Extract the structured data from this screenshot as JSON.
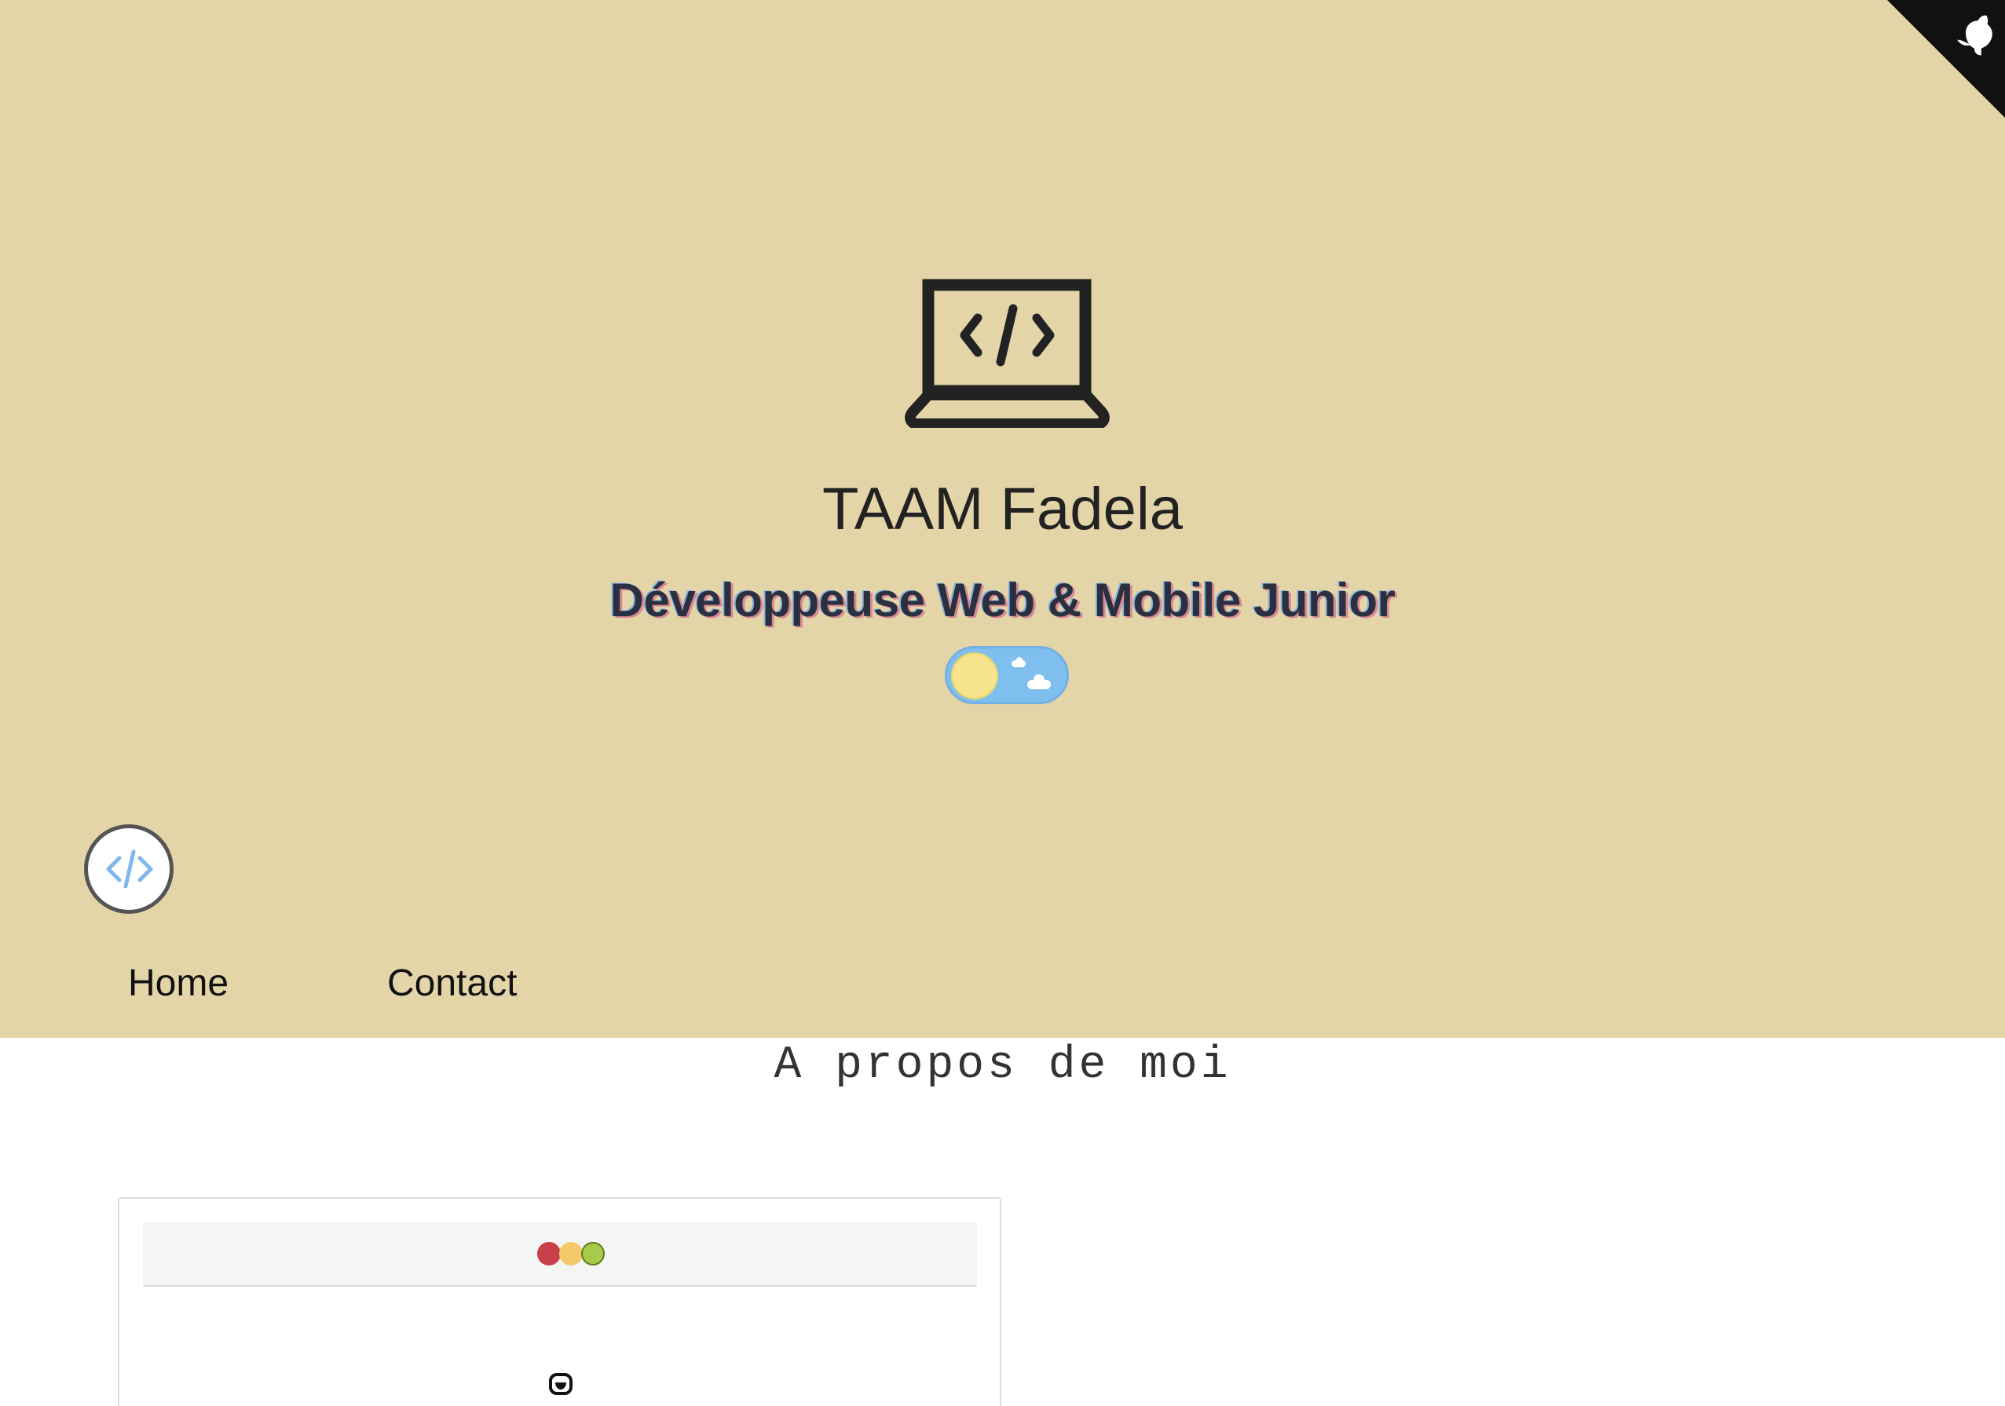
{
  "hero": {
    "title": "TAAM Fadela",
    "subtitle": "Développeuse Web & Mobile Junior",
    "background_color": "#e4d5a8",
    "icon": "laptop-code-icon"
  },
  "github_corner": {
    "icon": "github-octocat-icon",
    "color": "#111111"
  },
  "theme_toggle": {
    "state": "light",
    "knob_icon": "sun-icon",
    "track_icon": "cloud-icon",
    "track_color": "#7fbff0",
    "knob_color": "#f7e48c"
  },
  "logo": {
    "icon": "code-brackets-icon",
    "color": "#7fb8ec"
  },
  "nav": {
    "items": [
      {
        "label": "Home"
      },
      {
        "label": "Contact"
      }
    ]
  },
  "about": {
    "title": "A propos de moi"
  },
  "terminal": {
    "dots": [
      {
        "name": "close",
        "color": "#c9404a"
      },
      {
        "name": "minimize",
        "color": "#f5c96a"
      },
      {
        "name": "maximize",
        "color": "#a9c94a"
      }
    ],
    "icon": "terminal-face-icon"
  }
}
